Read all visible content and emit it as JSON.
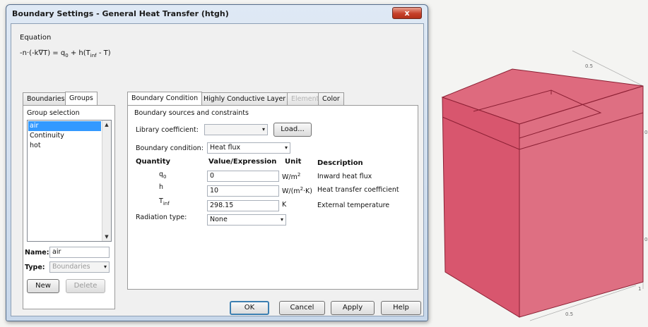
{
  "window": {
    "title": "Boundary Settings - General Heat Transfer (htgh)",
    "close_label": "x"
  },
  "equation": {
    "label": "Equation",
    "formula_lhs": "-n·(-k∇T) = q",
    "formula_sub0": "0",
    "formula_mid": " + h(T",
    "formula_sub_inf": "inf",
    "formula_end": " - T)"
  },
  "left_tabs": [
    "Boundaries",
    "Groups"
  ],
  "group_selection": {
    "label": "Group selection",
    "items": [
      "air",
      "Continuity",
      "hot"
    ],
    "selected": "air"
  },
  "name_field": {
    "label": "Name:",
    "value": "air"
  },
  "type_field": {
    "label": "Type:",
    "value": "Boundaries"
  },
  "group_buttons": {
    "new": "New",
    "delete": "Delete"
  },
  "right_tabs": [
    "Boundary Condition",
    "Highly Conductive Layer",
    "Element",
    "Color"
  ],
  "boundary": {
    "section_label": "Boundary sources and constraints",
    "library_label": "Library coefficient:",
    "library_value": "",
    "load_button": "Load...",
    "condition_label": "Boundary condition:",
    "condition_value": "Heat flux",
    "headers": {
      "quantity": "Quantity",
      "value": "Value/Expression",
      "unit": "Unit",
      "description": "Description"
    },
    "rows": [
      {
        "q_main": "q",
        "q_sub": "0",
        "value": "0",
        "unit_main": "W/m",
        "unit_sup": "2",
        "unit_end": "",
        "description": "Inward heat flux"
      },
      {
        "q_main": "h",
        "q_sub": "",
        "value": "10",
        "unit_main": "W/(m",
        "unit_sup": "2",
        "unit_end": "·K)",
        "description": "Heat transfer coefficient"
      },
      {
        "q_main": "T",
        "q_sub": "inf",
        "value": "298.15",
        "unit_main": "K",
        "unit_sup": "",
        "unit_end": "",
        "description": "External temperature"
      }
    ],
    "radiation_label": "Radiation type:",
    "radiation_value": "None"
  },
  "footer_buttons": {
    "ok": "OK",
    "cancel": "Cancel",
    "apply": "Apply",
    "help": "Help"
  },
  "plot": {
    "tick_top": "0.5",
    "tick_bottom": "0.5",
    "tick_corner": "1",
    "tick_axis_a": "0",
    "tick_axis_b": "0"
  },
  "colors": {
    "cube_fill": "#d9516a",
    "cube_edge": "#8a1f33",
    "titlebar": "#c7d7ea",
    "selection": "#3399ff"
  }
}
